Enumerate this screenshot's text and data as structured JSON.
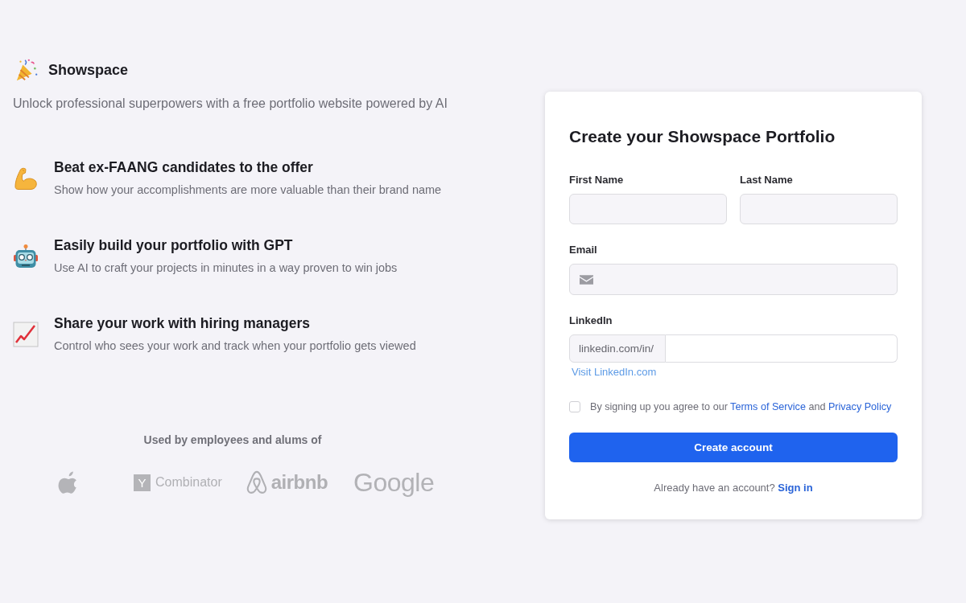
{
  "brand": {
    "name": "Showspace",
    "tagline": "Unlock professional superpowers with a free portfolio website powered by AI"
  },
  "features": [
    {
      "title": "Beat ex-FAANG candidates to the offer",
      "description": "Show how your accomplishments are more valuable than their brand name"
    },
    {
      "title": "Easily build your portfolio with GPT",
      "description": "Use AI to craft your projects in minutes in a way proven to win jobs"
    },
    {
      "title": "Share your work with hiring managers",
      "description": "Control who sees your work and track when your portfolio gets viewed"
    }
  ],
  "social_proof": {
    "heading": "Used by employees and alums of",
    "logos": [
      {
        "kind": "symbol"
      },
      {
        "kind": "boxed",
        "badge": "Y",
        "text": "Combinator"
      },
      {
        "kind": "emblem",
        "text": "airbnb"
      },
      {
        "kind": "wordmark",
        "text": "Google"
      }
    ]
  },
  "form": {
    "title": "Create your Showspace Portfolio",
    "fields": [
      {
        "kind": "text",
        "label": "First Name"
      },
      {
        "kind": "text",
        "label": "Last Name"
      },
      {
        "kind": "email",
        "label": "Email"
      },
      {
        "kind": "prefixed",
        "label": "LinkedIn",
        "prefix": "linkedin.com/in/",
        "link": "Visit LinkedIn.com"
      }
    ],
    "consent": {
      "checked": false,
      "parts": [
        {
          "kind": "text",
          "text": "By signing up you agree to our"
        },
        {
          "kind": "link",
          "text": "Terms of Service"
        },
        {
          "kind": "text",
          "text": "and"
        },
        {
          "kind": "link",
          "text": "Privacy Policy"
        }
      ]
    },
    "submit": "Create account",
    "signin": {
      "prompt": "Already have an account?",
      "link": "Sign in"
    }
  }
}
